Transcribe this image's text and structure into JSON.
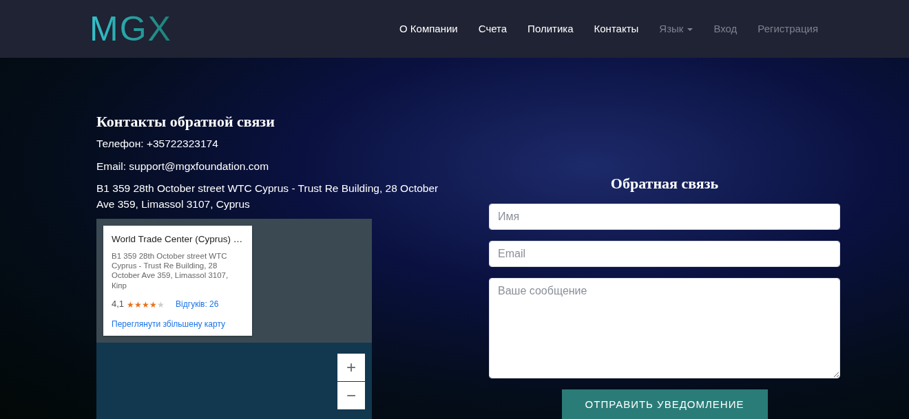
{
  "navbar": {
    "logo": "MGX",
    "items": [
      {
        "label": "О Компании",
        "muted": false,
        "dropdown": false
      },
      {
        "label": "Счета",
        "muted": false,
        "dropdown": false
      },
      {
        "label": "Политика",
        "muted": false,
        "dropdown": false
      },
      {
        "label": "Контакты",
        "muted": false,
        "dropdown": false
      },
      {
        "label": "Язык",
        "muted": true,
        "dropdown": true
      },
      {
        "label": "Вход",
        "muted": true,
        "dropdown": false
      },
      {
        "label": "Регистрация",
        "muted": true,
        "dropdown": false
      }
    ]
  },
  "contacts": {
    "title": "Контакты обратной связи",
    "lines": [
      "Телефон: +35722323174",
      "Email: support@mgxfoundation.com",
      "B1 359 28th October street WTC Cyprus - Trust Re Building, 28 October Ave 359, Limassol 3107, Cyprus"
    ]
  },
  "map": {
    "place_card": {
      "title": "World Trade Center (Cyprus) …",
      "address": "B1 359 28th October street WTC Cyprus - Trust Re Building, 28 October Ave 359, Limassol 3107, Кіпр",
      "rating": "4,1",
      "stars": 4,
      "reviews": "Відгуків: 26",
      "link": "Переглянути збільшену карту"
    },
    "zoom_in": "+",
    "zoom_out": "−"
  },
  "feedback": {
    "title": "Обратная связь",
    "fields": [
      {
        "kind": "input",
        "placeholder": "Имя"
      },
      {
        "kind": "input",
        "placeholder": "Email"
      },
      {
        "kind": "textarea",
        "placeholder": "Ваше сообщение"
      }
    ],
    "submit": "ОТПРАВИТЬ УВЕДОМЛЕНИЕ"
  }
}
